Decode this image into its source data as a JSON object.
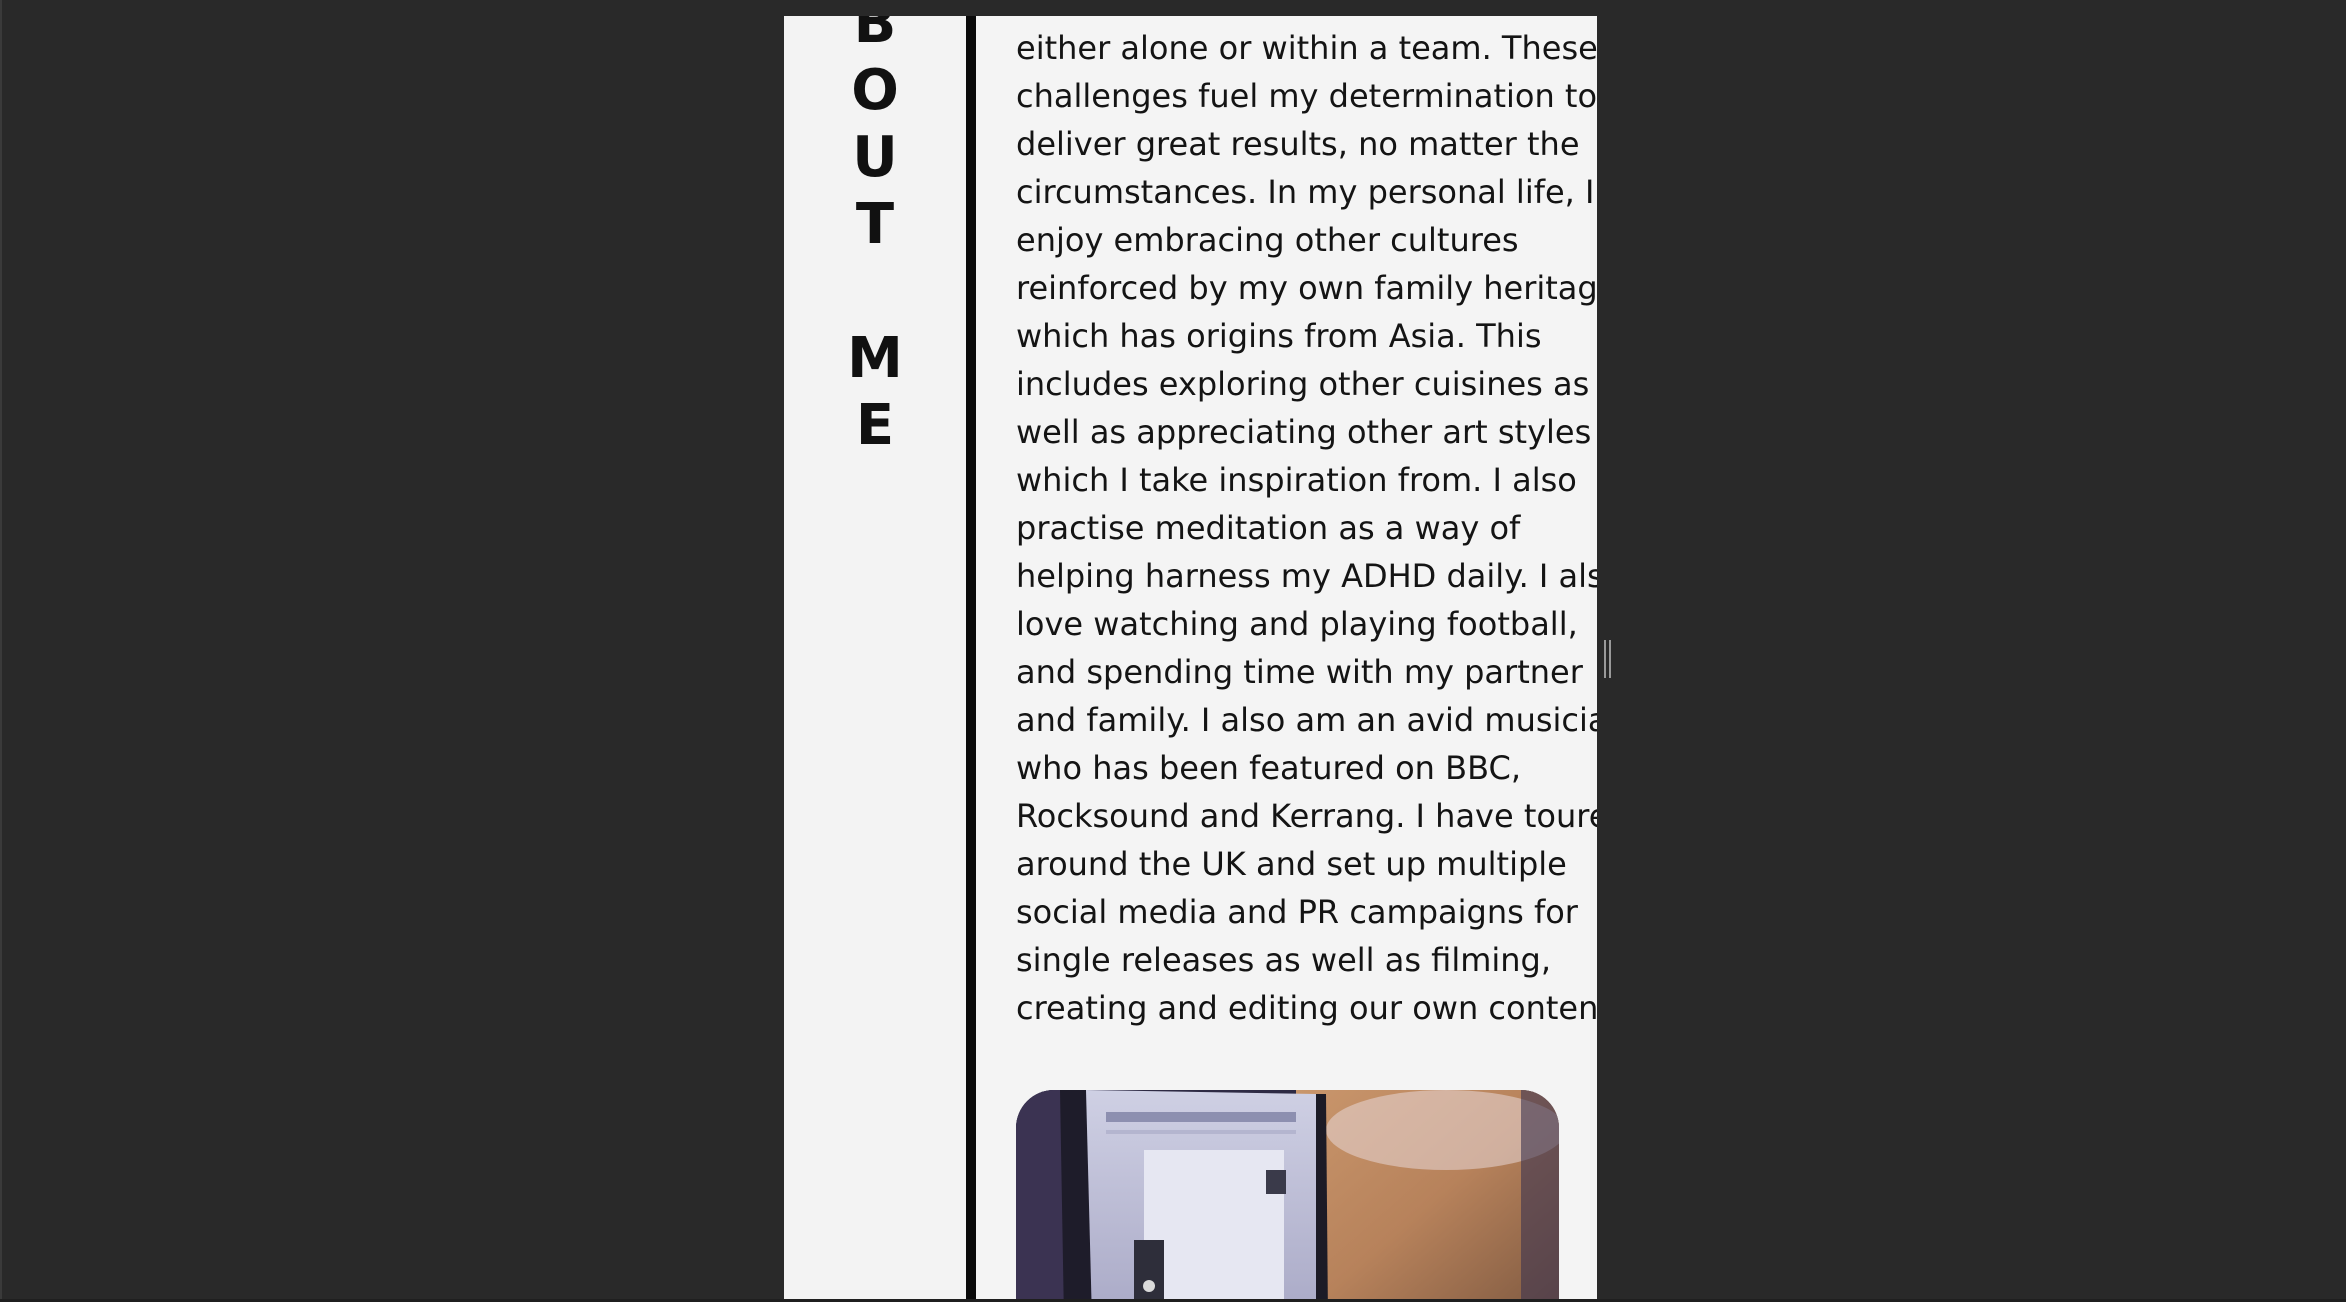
{
  "page": {
    "section_title_letters": [
      "B",
      "O",
      "U",
      "T",
      "",
      "M",
      "E"
    ],
    "body_lines": [
      "either alone or within a team. These",
      "challenges fuel my determination to",
      "deliver great results, no matter the",
      "circumstances. In my personal life, I",
      "enjoy embracing other cultures",
      "reinforced by my own family heritage",
      "which has origins from Asia. This",
      "includes exploring other cuisines as",
      "well as appreciating other art styles",
      "which I take inspiration from. I also",
      "practise meditation as a way of",
      "helping harness my ADHD daily. I also",
      "love watching and playing football,",
      "and spending time with my partner",
      "and family. I also am an avid musician",
      "who has been featured on BBC,",
      "Rocksound and Kerrang. I have toured",
      "around the UK and set up multiple",
      "social media and PR campaigns for",
      "single releases as well as filming,",
      "creating and editing our own content."
    ]
  },
  "colors": {
    "backdrop": "#292929",
    "page_background": "#f3f3f3",
    "divider": "#0a0a0a",
    "text": "#141414"
  },
  "icons": {
    "scroll_grip": "resize-grip-icon"
  }
}
